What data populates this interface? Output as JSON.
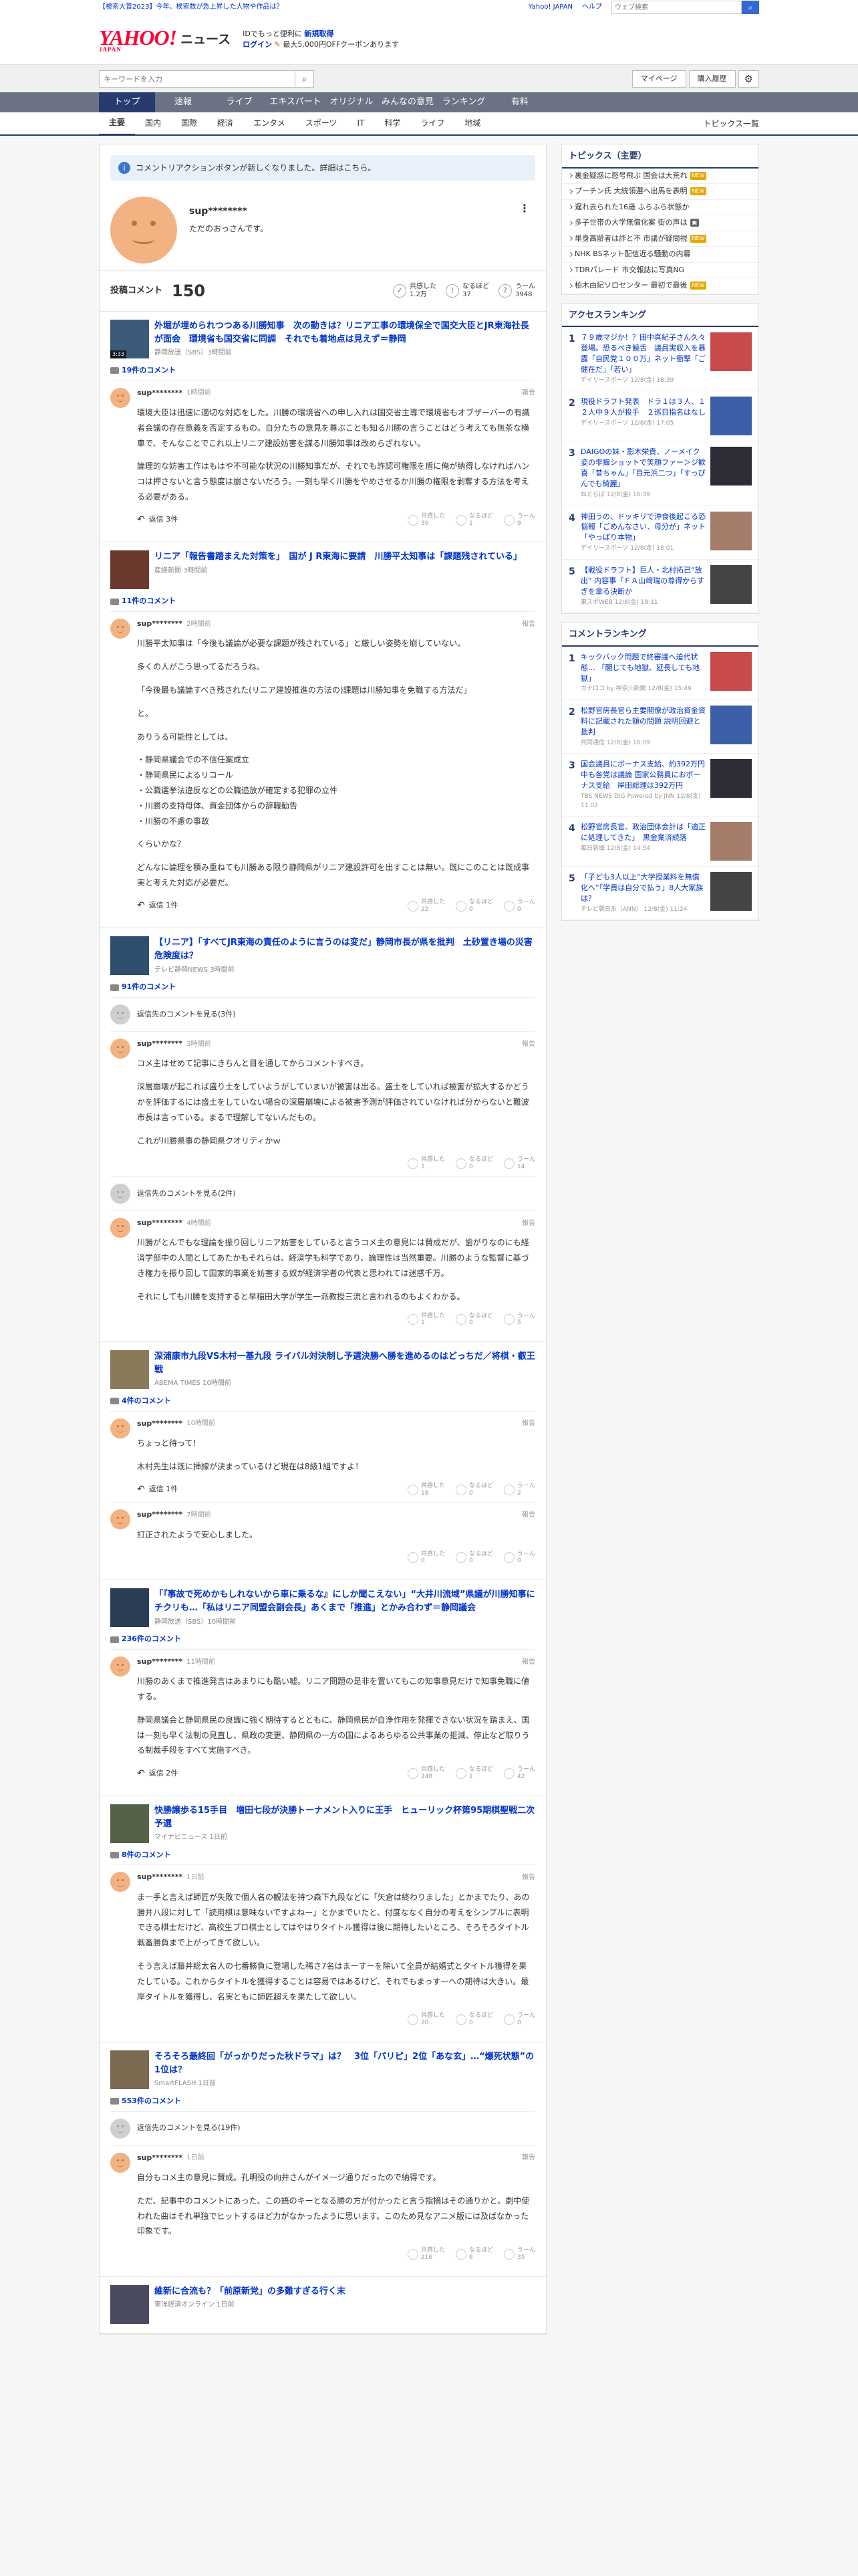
{
  "topbar": {
    "left_link": "【検索大賞2023】今年、検索数が急上昇した人物や作品は？",
    "links": [
      "Yahoo! JAPAN",
      "ヘルプ"
    ],
    "search_placeholder": "ウェブ検索"
  },
  "header": {
    "logo": "YAHOO!",
    "logo_sub": "JAPAN",
    "section": "ニュース",
    "promo_line1_a": "IDでもっと便利に",
    "promo_line1_b": "新規取得",
    "promo_line2_a": "ログイン",
    "promo_line2_b": "最大5,000円OFFクーポンあります"
  },
  "searchrow": {
    "placeholder": "キーワードを入力",
    "mypage": "マイページ",
    "purchased": "購入履歴"
  },
  "nav": [
    "トップ",
    "速報",
    "ライブ",
    "エキスパート",
    "オリジナル",
    "みんなの意見",
    "ランキング",
    "有料"
  ],
  "subnav": [
    "主要",
    "国内",
    "国際",
    "経済",
    "エンタメ",
    "スポーツ",
    "IT",
    "科学",
    "ライフ",
    "地域"
  ],
  "subnav_more": "トピックス一覧",
  "notice": "コメントリアクションボタンが新しくなりました。詳細はこちら。",
  "profile": {
    "name": "sup********",
    "bio": "ただのおっさんです。",
    "comments_label": "投稿コメント",
    "comments_count": "150",
    "reactions": [
      {
        "label": "共感した",
        "value": "1.2万"
      },
      {
        "label": "なるほど",
        "value": "37"
      },
      {
        "label": "うーん",
        "value": "3948"
      }
    ]
  },
  "articles": [
    {
      "title": "外堀が埋められつつある川勝知事　次の動きは？リニア工事の環境保全で国交大臣とJR東海社長が面会　環境省も国交省に同調　それでも着地点は見えず＝静岡",
      "source": "静岡放送（SBS）3時間前",
      "count": "19件のコメント",
      "video": "3:33",
      "comments": [
        {
          "user": "sup********",
          "time": "1時間前",
          "paras": [
            "環境大臣は迅速に適切な対応をした。川勝の環境省への申し入れは国交省主導で環境省もオブザーバーの有識者会議の存在意義を否定するもの。自分たちの意見を尊ぶことも知る川勝の言うことはどう考えても無茶な横車で、そんなことでこれ以上リニア建設妨害を謀る川勝知事は改めらざれない。",
            "論理的な妨害工作はもはや不可能な状況の川勝知事だが、それでも許認可権限を盾に俺が納得しなければハンコは押さないと言う態度は崩さないだろう。一刻も早く川勝をやめさせるか川勝の権限を剥奪する方法を考える必要がある。"
          ],
          "reply": "返信 3件",
          "r": [
            "30",
            "1",
            "9"
          ]
        }
      ]
    },
    {
      "title": "リニア「報告書踏まえた対策を」　国が J R東海に要請　川勝平太知事は「課題残されている」",
      "source": "産経新聞 3時間前",
      "count": "11件のコメント",
      "comments": [
        {
          "user": "sup********",
          "time": "2時間前",
          "paras": [
            "川勝平太知事は「今後も議論が必要な課題が残されている」と厳しい姿勢を崩していない。",
            "多くの人がこう思ってるだろうね。",
            "「今後最も議論すべき残された(リニア建設推進の方法の)課題は川勝知事を免職する方法だ」",
            "と。",
            "ありうる可能性としては、",
            "・静岡県議会での不信任案成立\n・静岡県民によるリコール\n・公職選挙法違反などの公職追放が確定する犯罪の立件\n・川勝の支持母体、資金団体からの辞職勧告\n・川勝の不慮の事故",
            "くらいかな？",
            "どんなに論理を積み重ねても川勝ある限り静岡県がリニア建設許可を出すことは無い。既にこのことは既成事実と考えた対応が必要だ。"
          ],
          "reply": "返信 1件",
          "r": [
            "22",
            "0",
            "0"
          ]
        }
      ]
    },
    {
      "title": "【リニア】「すべてJR東海の責任のように言うのは変だ」静岡市長が県を批判　土砂置き場の災害危険度は？",
      "source": "テレビ静岡NEWS 3時間前",
      "count": "91件のコメント",
      "gray1": "返信先のコメントを見る(3件)",
      "comments": [
        {
          "user": "sup********",
          "time": "3時間前",
          "paras": [
            "コメ主はせめて記事にきちんと目を通してからコメントすべき。",
            "深層崩壊が起これば盛り土をしていようがしていまいが被害は出る。盛土をしていれば被害が拡大するかどうかを評価するには盛土をしていない場合の深層崩壊による被害予測が評価されていなければ分からないと難波市長は言っている。まるで理解してないんだもの。",
            "これが川勝県事の静岡県クオリティかｗ"
          ],
          "reply": "",
          "r": [
            "1",
            "0",
            "14"
          ]
        }
      ],
      "gray2": "返信先のコメントを見る(2件)",
      "comments2": [
        {
          "user": "sup********",
          "time": "4時間前",
          "paras": [
            "川勝がとんでもな理論を振り回しリニア妨害をしていると言うコメ主の意見には賛成だが、歯がりなのにも経済学部中の人間としてあたかもそれらは、経済学も科学であり、論理性は当然重要。川勝のような監督に基づき権力を振り回して国家的事業を妨害する奴が経済学者の代表と思われては迷惑千万。",
            "それにしても川勝を支持すると早稲田大学が学生一派教授三流と言われるのもよくわかる。"
          ],
          "reply": "",
          "r": [
            "1",
            "0",
            "5"
          ]
        }
      ]
    },
    {
      "title": "深浦康市九段VS木村一基九段 ライバル対決制し予選決勝へ勝を進めるのはどっちだ／将棋・叡王戦",
      "source": "ABEMA TIMES 10時間前",
      "count": "4件のコメント",
      "comments": [
        {
          "user": "sup********",
          "time": "10時間前",
          "paras": [
            "ちょっと待って！",
            "木村先生は既に挿線が決まっているけど現在は8級1組ですよ！"
          ],
          "reply": "返信 1件",
          "r": [
            "18",
            "0",
            "2"
          ]
        },
        {
          "user": "sup********",
          "time": "7時間前",
          "paras": [
            "訂正されたようで安心しました。"
          ],
          "reply": "",
          "r": [
            "0",
            "0",
            "0"
          ]
        }
      ]
    },
    {
      "title": "「『事故で死めかもしれないから車に乗るな』にしか聞こえない」“大井川流域”県議が川勝知事にチクリも…「私はリニア同盟会副会長」あくまで「推進」とかみ合わず＝静岡議会",
      "source": "静岡放送（SBS）10時間前",
      "count": "236件のコメント",
      "comments": [
        {
          "user": "sup********",
          "time": "11時間前",
          "paras": [
            "川勝のあくまで推進発言はあまりにも酷い嘘。リニア問題の是非を置いてもこの知事意見だけで知事免職に値する。",
            "静岡県議会と静岡県民の良識に強く期待するとともに、静岡県民が自浄作用を発揮できない状況を踏まえ、国は一刻も早く法制の見直し、県政の変更、静岡県の一方の国によるあらゆる公共事業の拒減、停止など取りうる制裁手段をすべて実施すべき。"
          ],
          "reply": "返信 2件",
          "r": [
            "248",
            "1",
            "42"
          ]
        }
      ]
    },
    {
      "title": "快勝譲歩る15手目　増田七段が決勝トーナメント入りに王手　ヒューリック杯第95期棋聖戦二次予選",
      "source": "マイナビニュース 1日前",
      "count": "8件のコメント",
      "comments": [
        {
          "user": "sup********",
          "time": "1日前",
          "paras": [
            "ま一手と言えば師匠が失敗で個人名の観法を持つ森下九段などに「矢倉は終わりました」とかまでたり、あの勝井八段に対して「読用棋は意味ないですよねー」とかまでいたと、付度ななく自分の考えをシンプルに表明できる棋士だけど、高校生プロ棋士としてはやはりタイトル獲得は後に期待したいところ、そろそろタイトル戦番勝負まで上がってきて欲しい。",
            "そう言えば藤井総太名人の七番勝負に登場した稀さ7名はまーすーを除いて全員が結婚式とタイトル獲得を果たしている。これからタイトルを獲得することは容易ではあるけど、それでもまっすーへの期待は大きい。最岸タイトルを獲得し、名実ともに師匠超えを果たして欲しい。"
          ],
          "reply": "",
          "r": [
            "20",
            "0",
            "0"
          ]
        }
      ]
    },
    {
      "title": "そろそろ最終回「がっかりだった秋ドラマ」は？　3位「パリピ」2位「あな玄」…“爆死状態”の1位は？",
      "source": "SmartFLASH 1日前",
      "count": "553件のコメント",
      "gray1": "返信先のコメントを見る(19件)",
      "comments": [
        {
          "user": "sup********",
          "time": "1日前",
          "paras": [
            "自分もコメ主の意見に賛成。孔明役の向井さんがイメージ通りだったので納得です。",
            "ただ、記事中のコメントにあった、この語のキーとなる勝の方が付かったと言う指摘はその通りかと。劇中使われた曲はそれ単独でヒットするほど力がなかったように思います。このため見なアニメ版には及ばなかった印象です。"
          ],
          "reply": "",
          "r": [
            "216",
            "6",
            "35"
          ]
        }
      ]
    },
    {
      "title": "維新に合流も？「前原新党」の多難すぎる行く末",
      "source": "東洋経済オンライン 1日前",
      "count": "",
      "comments": []
    }
  ],
  "sidebar": {
    "topics_title": "トピックス（主要）",
    "topics": [
      {
        "t": "裏金疑惑に怒号飛ぶ 国会は大荒れ",
        "tag": "NEW"
      },
      {
        "t": "プーチン氏 大統領選へ出馬を表明",
        "tag": "NEW"
      },
      {
        "t": "遅れ去られた16歳 ふらふら状態か",
        "tag": ""
      },
      {
        "t": "多子世帯の大学無償化案 街の声は",
        "tag": "img"
      },
      {
        "t": "単身高齢者は詐と不 市議が疑問視",
        "tag": "NEW"
      },
      {
        "t": "NHK BSネット配信近る騒動の内幕",
        "tag": ""
      },
      {
        "t": "TDRパレード 市交報誌に写真NG",
        "tag": ""
      },
      {
        "t": "柏木由紀ソロセンター 最初で最後",
        "tag": "NEW"
      }
    ],
    "access_title": "アクセスランキング",
    "access": [
      {
        "n": "1",
        "t": "７９歳マジか！？田中真紀子さん久々登場。恐るべき饒舌　議員実収入を暴露「自民党１００万」ネット衝撃「ご健在だ」「若い」",
        "s": "デイリースポーツ 12/8(金) 18:39"
      },
      {
        "n": "2",
        "t": "現役ドラフト発表　ドラ１は３人、１２人中９人が投手　２巡目指名はなし",
        "s": "デイリースポーツ 12/8(金) 17:05"
      },
      {
        "n": "3",
        "t": "DAIGOの妹・影木栄貴、ノーメイク姿の非撮ショットで笑顔ファー＞ジ歓喜「昔ちゃん」「目元浜二つ」「すっぴんでも綺麗」",
        "s": "ねとらぼ 12/8(金) 16:39"
      },
      {
        "n": "4",
        "t": "神田うの、ドッキリで沖食後起こる恐悩報「ごめんなさい、母分が」ネット「やっぱり本物」",
        "s": "デイリースポーツ 12/8(金) 18:01"
      },
      {
        "n": "5",
        "t": "【戦役ドラフト】巨人・北村拓己“放出” 内容事「ＦＡ山﨑瑞の尊得からすぎを拿る決断か",
        "s": "東スポWEB 12/8(金) 18:11"
      }
    ],
    "comment_title": "コメントランキング",
    "crank": [
      {
        "n": "1",
        "t": "キックバック問題で終審議へ迫代状態… 「閣じても地獄、延長しても地獄」",
        "s": "カナロコ by 神奈川新聞 12/8(金) 15:49"
      },
      {
        "n": "2",
        "t": "松野官房長官ら主要閣僚が政治資金資料に記載された額の問題 説明回避と批判",
        "s": "共同通信 12/8(金) 16:09"
      },
      {
        "n": "3",
        "t": "国会議員にボーナス支給、約392万円中も各党は議論 国家公務員におボーナス支給　岸田総理は392万円",
        "s": "TBS NEWS DIG Powered by JNN 12/8(金) 11:02"
      },
      {
        "n": "4",
        "t": "松野官房長官、政治団体会計は「適正に処理してきた」　黒金業済続落",
        "s": "毎日新聞 12/8(金) 14:54"
      },
      {
        "n": "5",
        "t": "「子ども3人以上“大学授業料を無償化へ”「学費は自分で払う」8人大家族は？",
        "s": "テレビ朝日系（ANN） 12/8(金) 11:24"
      }
    ]
  }
}
